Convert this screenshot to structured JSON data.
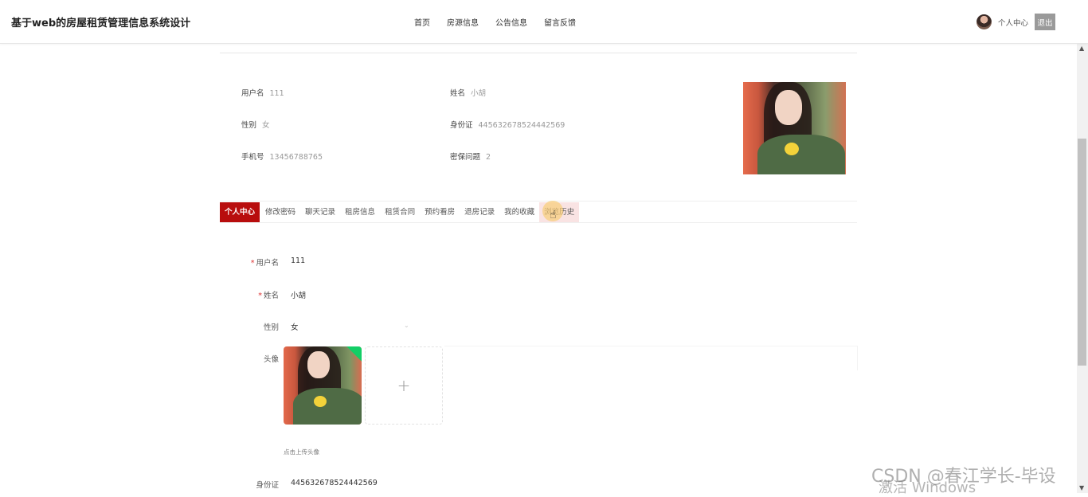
{
  "header": {
    "site_title": "基于web的房屋租赁管理信息系统设计",
    "nav": [
      "首页",
      "房源信息",
      "公告信息",
      "留言反馈"
    ],
    "user_center": "个人中心",
    "logout": "退出"
  },
  "section": {
    "title": "个人中心"
  },
  "profile": {
    "username_label": "用户名",
    "username": "111",
    "name_label": "姓名",
    "name": "小胡",
    "gender_label": "性别",
    "gender": "女",
    "id_label": "身份证",
    "id_number": "445632678524442569",
    "phone_label": "手机号",
    "phone": "13456788765",
    "security_label": "密保问题",
    "security": "2"
  },
  "tabs": [
    "个人中心",
    "修改密码",
    "聊天记录",
    "租房信息",
    "租赁合同",
    "预约看房",
    "退房记录",
    "我的收藏",
    "浏览历史"
  ],
  "form": {
    "username_label": "用户名",
    "username": "111",
    "name_label": "姓名",
    "name": "小胡",
    "gender_label": "性别",
    "gender": "女",
    "avatar_label": "头像",
    "upload_tip": "点击上传头像",
    "id_label": "身份证",
    "id_number": "445632678524442569"
  },
  "watermarks": {
    "csdn": "CSDN @春江学长-毕设",
    "windows": "激活 Windows"
  },
  "colors": {
    "accent": "#b80d0d",
    "success": "#13ce66",
    "logout_bg": "#9a9a9a"
  }
}
